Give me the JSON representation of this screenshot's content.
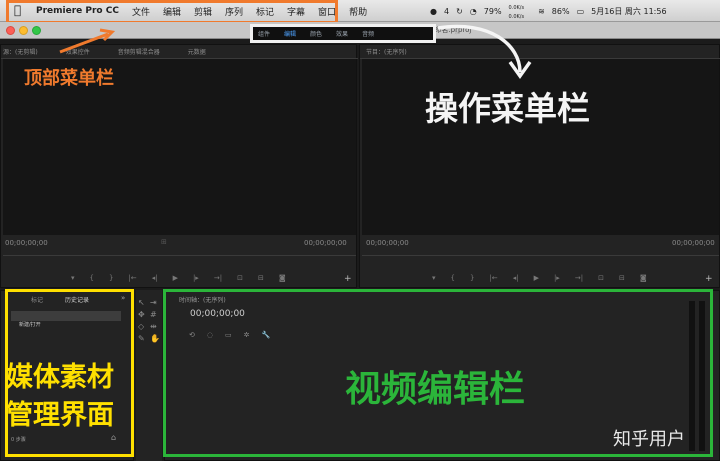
{
  "menubar": {
    "apple": "",
    "app_name": "Premiere Pro CC",
    "items": [
      "文件",
      "编辑",
      "剪辑",
      "序列",
      "标记",
      "字幕",
      "窗口",
      "帮助"
    ],
    "status_num": "4",
    "battery_pct": "79%",
    "net_up": "0.0K/s",
    "net_down": "0.0K/s",
    "wifi_pct": "86%",
    "date_time": "5月16日 周六 11:56"
  },
  "window": {
    "title": "/Users/...Premiere Pro/9.0/未命名.prproj"
  },
  "workspaces": {
    "items": [
      "组件",
      "编辑",
      "颜色",
      "效果",
      "音频"
    ],
    "active": "编辑",
    "more": "»"
  },
  "source_panel": {
    "tabs": [
      "源：(无剪辑)",
      "效果控件",
      "音频剪辑混合器",
      "元数据"
    ],
    "timecode_left": "00;00;00;00",
    "timecode_right": "00;00;00;00"
  },
  "program_panel": {
    "tab": "节目：(无序列)",
    "timecode_left": "00;00;00;00",
    "timecode_right": "00;00;00;00"
  },
  "project_panel": {
    "tabs": [
      "标记",
      "历史记录"
    ],
    "item": "新建/打开",
    "footer": "0 步骤"
  },
  "timeline_panel": {
    "tab": "时间轴：(无序列)",
    "timecode": "00;00;00;00"
  },
  "annotations": {
    "top_menu": "顶部菜单栏",
    "operation_menu": "操作菜单栏",
    "media_line1": "媒体素材",
    "media_line2": "管理界面",
    "video_edit": "视频编辑栏",
    "watermark": "知乎用户"
  },
  "colors": {
    "orange": "#f07a2d",
    "yellow": "#ffe000",
    "green": "#2bb53a",
    "workspace_active": "#4ea3ff"
  }
}
